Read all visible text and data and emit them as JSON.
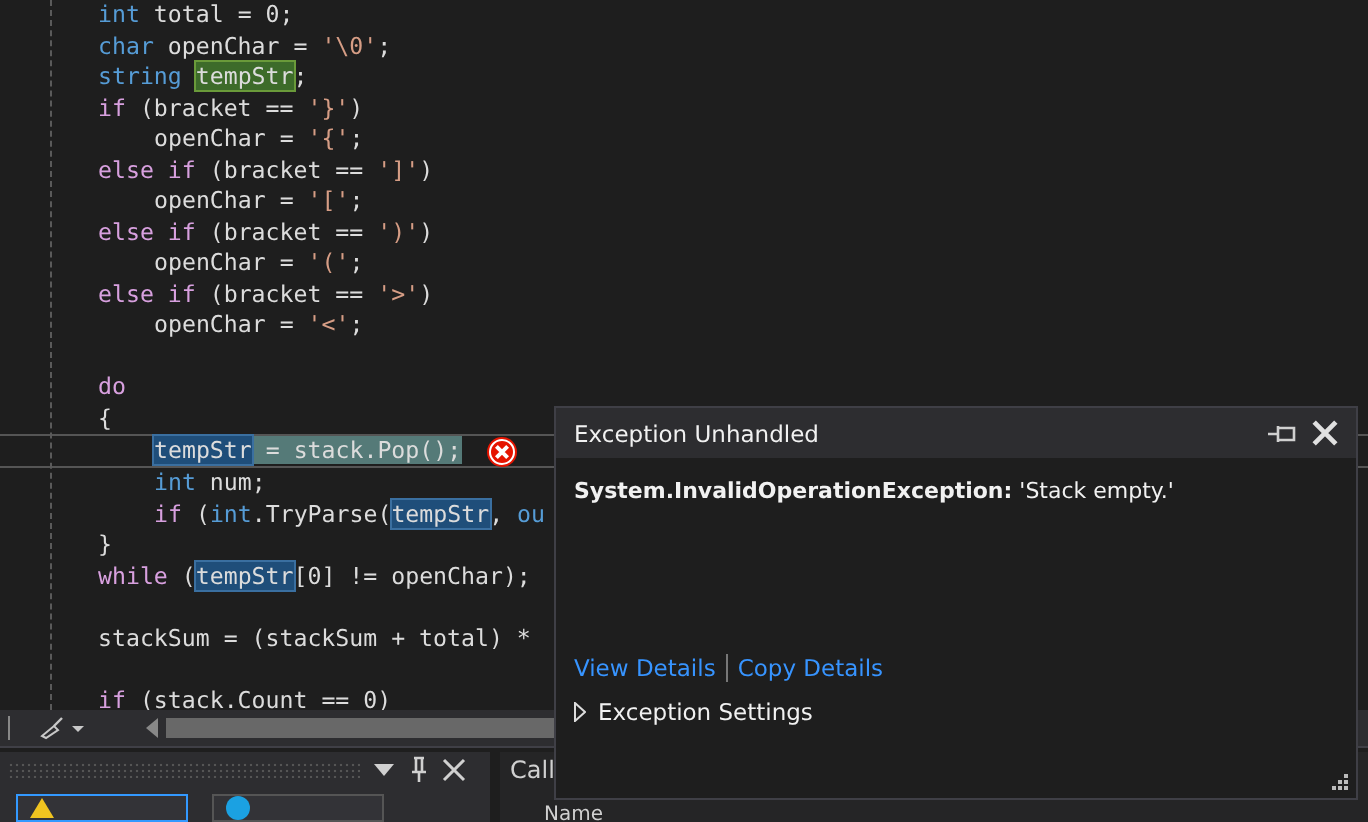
{
  "code": {
    "lines": [
      {
        "kind": "code",
        "indented": false,
        "current": false,
        "tokens": [
          {
            "text": "int",
            "kind": "kw"
          },
          {
            "text": " total = 0;",
            "kind": "id"
          }
        ]
      },
      {
        "kind": "code",
        "indented": false,
        "current": false,
        "tokens": [
          {
            "text": "char",
            "kind": "kw"
          },
          {
            "text": " openChar = ",
            "kind": "id"
          },
          {
            "text": "'\\0'",
            "kind": "str"
          },
          {
            "text": ";",
            "kind": "id"
          }
        ]
      },
      {
        "kind": "code",
        "indented": false,
        "current": false,
        "tokens": [
          {
            "text": "string ",
            "kind": "kw"
          },
          {
            "text": "tempStr",
            "kind": "definition"
          },
          {
            "text": ";",
            "kind": "id"
          }
        ]
      },
      {
        "kind": "code",
        "indented": false,
        "current": false,
        "tokens": [
          {
            "text": "if",
            "kind": "ctl"
          },
          {
            "text": " (bracket == ",
            "kind": "id"
          },
          {
            "text": "'}'",
            "kind": "str"
          },
          {
            "text": ")",
            "kind": "id"
          }
        ]
      },
      {
        "kind": "code",
        "indented": true,
        "current": false,
        "tokens": [
          {
            "text": "openChar = ",
            "kind": "id"
          },
          {
            "text": "'{'",
            "kind": "str"
          },
          {
            "text": ";",
            "kind": "id"
          }
        ]
      },
      {
        "kind": "code",
        "indented": false,
        "current": false,
        "tokens": [
          {
            "text": "else if",
            "kind": "ctl"
          },
          {
            "text": " (bracket == ",
            "kind": "id"
          },
          {
            "text": "']'",
            "kind": "str"
          },
          {
            "text": ")",
            "kind": "id"
          }
        ]
      },
      {
        "kind": "code",
        "indented": true,
        "current": false,
        "tokens": [
          {
            "text": "openChar = ",
            "kind": "id"
          },
          {
            "text": "'['",
            "kind": "str"
          },
          {
            "text": ";",
            "kind": "id"
          }
        ]
      },
      {
        "kind": "code",
        "indented": false,
        "current": false,
        "tokens": [
          {
            "text": "else if",
            "kind": "ctl"
          },
          {
            "text": " (bracket == ",
            "kind": "id"
          },
          {
            "text": "')'",
            "kind": "str"
          },
          {
            "text": ")",
            "kind": "id"
          }
        ]
      },
      {
        "kind": "code",
        "indented": true,
        "current": false,
        "tokens": [
          {
            "text": "openChar = ",
            "kind": "id"
          },
          {
            "text": "'('",
            "kind": "str"
          },
          {
            "text": ";",
            "kind": "id"
          }
        ]
      },
      {
        "kind": "code",
        "indented": false,
        "current": false,
        "tokens": [
          {
            "text": "else if",
            "kind": "ctl"
          },
          {
            "text": " (bracket == ",
            "kind": "id"
          },
          {
            "text": "'>'",
            "kind": "str"
          },
          {
            "text": ")",
            "kind": "id"
          }
        ]
      },
      {
        "kind": "code",
        "indented": true,
        "current": false,
        "tokens": [
          {
            "text": "openChar = ",
            "kind": "id"
          },
          {
            "text": "'<'",
            "kind": "str"
          },
          {
            "text": ";",
            "kind": "id"
          }
        ]
      },
      {
        "kind": "blank"
      },
      {
        "kind": "code",
        "indented": false,
        "current": false,
        "tokens": [
          {
            "text": "do",
            "kind": "ctl"
          }
        ]
      },
      {
        "kind": "code",
        "indented": false,
        "current": false,
        "tokens": [
          {
            "text": "{",
            "kind": "id"
          }
        ]
      },
      {
        "kind": "code",
        "indented": true,
        "current": true,
        "tokens": [
          {
            "text": "tempStr",
            "kind": "reference"
          },
          {
            "text": " = stack.Pop();",
            "kind": "statement"
          }
        ]
      },
      {
        "kind": "code",
        "indented": true,
        "current": false,
        "tokens": [
          {
            "text": "int",
            "kind": "kw"
          },
          {
            "text": " num;",
            "kind": "id"
          }
        ]
      },
      {
        "kind": "code",
        "indented": true,
        "current": false,
        "tokens": [
          {
            "text": "if",
            "kind": "ctl"
          },
          {
            "text": " (",
            "kind": "id"
          },
          {
            "text": "int",
            "kind": "kw"
          },
          {
            "text": ".TryParse(",
            "kind": "id"
          },
          {
            "text": "tempStr",
            "kind": "reference"
          },
          {
            "text": ", ",
            "kind": "id"
          },
          {
            "text": "ou",
            "kind": "kw"
          }
        ]
      },
      {
        "kind": "code",
        "indented": false,
        "current": false,
        "tokens": [
          {
            "text": "}",
            "kind": "id"
          }
        ]
      },
      {
        "kind": "code",
        "indented": false,
        "current": false,
        "tokens": [
          {
            "text": "while",
            "kind": "ctl"
          },
          {
            "text": " (",
            "kind": "id"
          },
          {
            "text": "tempStr",
            "kind": "reference"
          },
          {
            "text": "[0] != openChar);",
            "kind": "id"
          }
        ]
      },
      {
        "kind": "blank"
      },
      {
        "kind": "code",
        "indented": false,
        "current": false,
        "tokens": [
          {
            "text": "stackSum = (stackSum + total) *",
            "kind": "id"
          }
        ]
      },
      {
        "kind": "blank"
      },
      {
        "kind": "code",
        "indented": false,
        "current": false,
        "tokens": [
          {
            "text": "if",
            "kind": "ctl"
          },
          {
            "text": " (stack.Count == 0)",
            "kind": "id"
          }
        ]
      }
    ]
  },
  "exception_popup": {
    "title": "Exception Unhandled",
    "message": "**System.InvalidOperationException:** 'Stack empty.'",
    "links": [
      "View Details",
      "Copy Details"
    ],
    "settings": {
      "label": "Exception Settings",
      "expanded": false
    }
  },
  "bottom_panel": {
    "call_title": "Call",
    "column": "Name"
  }
}
